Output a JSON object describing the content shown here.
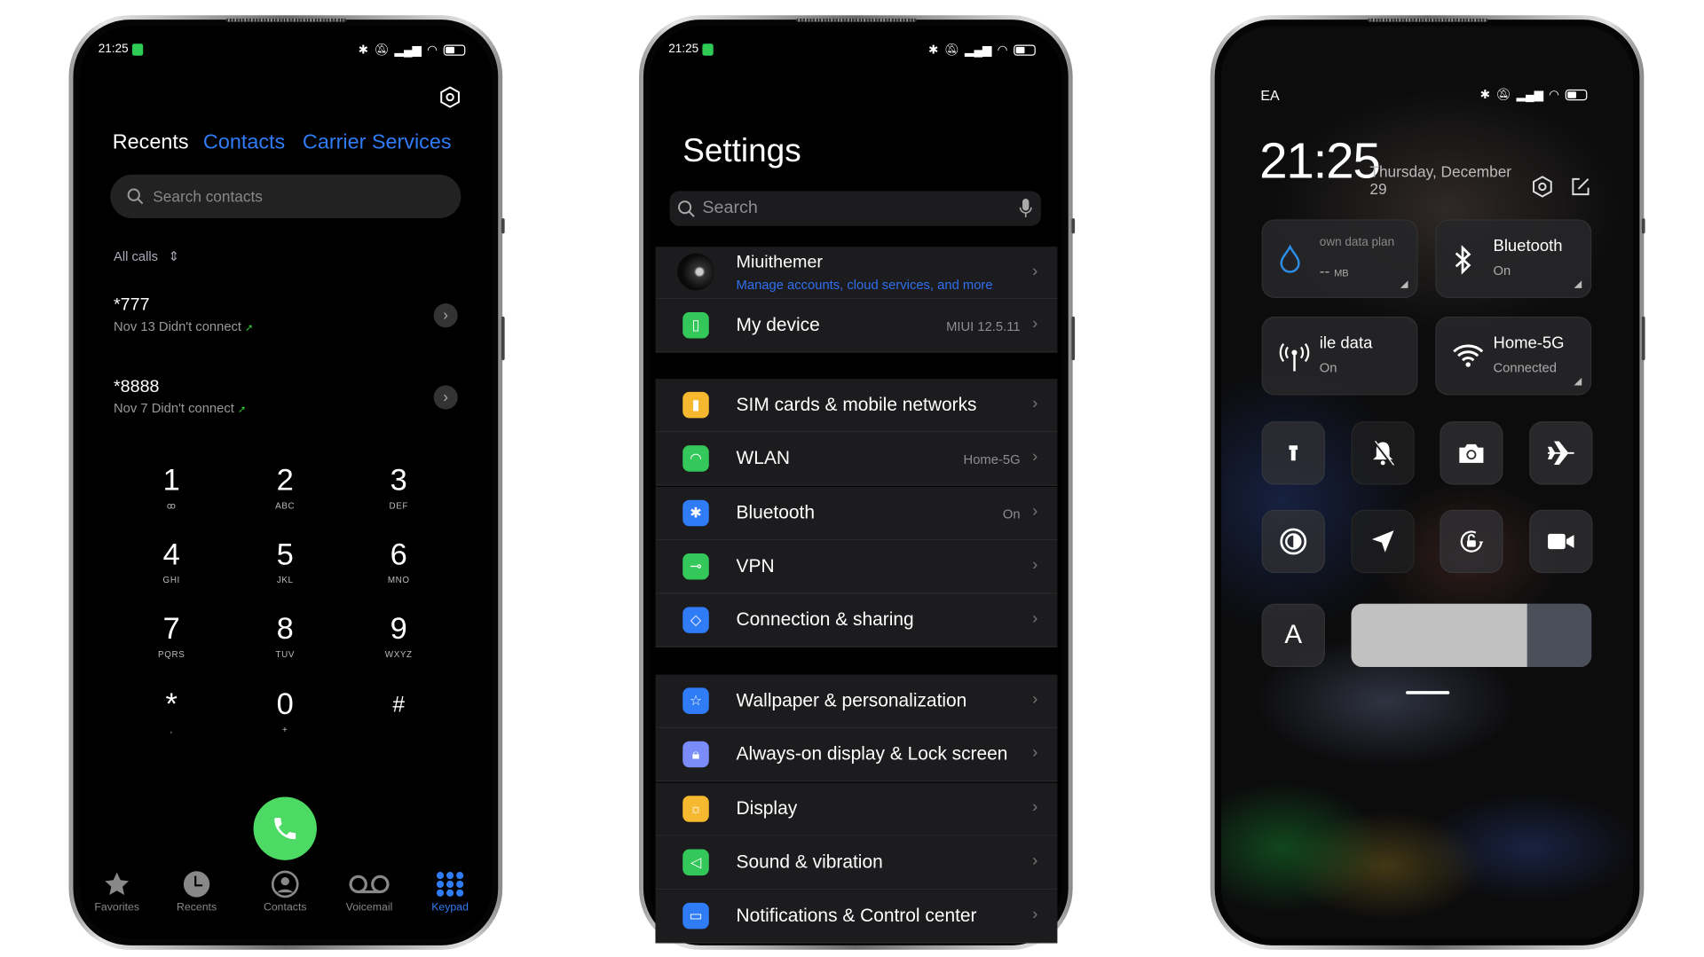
{
  "colors": {
    "accent_blue": "#2f7cf6",
    "call_green": "#4cd964",
    "row_bg": "#1c1c1e",
    "data_drop": "#2b8fe8"
  },
  "dialer": {
    "status_time": "21:25",
    "tabs": [
      {
        "label": "Recents",
        "active": true
      },
      {
        "label": "Contacts",
        "active": false
      },
      {
        "label": "Carrier Services",
        "active": false
      }
    ],
    "search_placeholder": "Search contacts",
    "filter_label": "All calls",
    "recents": [
      {
        "number": "*777",
        "detail": "Nov 13 Didn't connect"
      },
      {
        "number": "*8888",
        "detail": "Nov 7 Didn't connect"
      }
    ],
    "keys": [
      {
        "d": "1",
        "s": "ꝏ"
      },
      {
        "d": "2",
        "s": "ABC"
      },
      {
        "d": "3",
        "s": "DEF"
      },
      {
        "d": "4",
        "s": "GHI"
      },
      {
        "d": "5",
        "s": "JKL"
      },
      {
        "d": "6",
        "s": "MNO"
      },
      {
        "d": "7",
        "s": "PQRS"
      },
      {
        "d": "8",
        "s": "TUV"
      },
      {
        "d": "9",
        "s": "WXYZ"
      },
      {
        "d": "*",
        "s": ","
      },
      {
        "d": "0",
        "s": "+"
      },
      {
        "d": "#",
        "s": ""
      }
    ],
    "nav": [
      {
        "label": "Favorites",
        "icon": "star-icon"
      },
      {
        "label": "Recents",
        "icon": "clock-icon"
      },
      {
        "label": "Contacts",
        "icon": "person-icon"
      },
      {
        "label": "Voicemail",
        "icon": "voicemail-icon"
      },
      {
        "label": "Keypad",
        "icon": "keypad-icon",
        "active": true
      }
    ]
  },
  "settings": {
    "status_time": "21:25",
    "title": "Settings",
    "search_placeholder": "Search",
    "account": {
      "name": "Miuithemer",
      "subtitle": "Manage accounts, cloud services, and more"
    },
    "groups": [
      [
        {
          "label": "My device",
          "value": "MIUI 12.5.11",
          "icon": "phone-icon",
          "color": "#34c759"
        }
      ],
      [
        {
          "label": "SIM cards & mobile networks",
          "value": "",
          "icon": "sim-icon",
          "color": "#f5b82e"
        },
        {
          "label": "WLAN",
          "value": "Home-5G",
          "icon": "wifi-icon",
          "color": "#34c759"
        },
        {
          "label": "Bluetooth",
          "value": "On",
          "icon": "bluetooth-icon",
          "color": "#2f7cf6"
        },
        {
          "label": "VPN",
          "value": "",
          "icon": "key-icon",
          "color": "#34c759"
        },
        {
          "label": "Connection & sharing",
          "value": "",
          "icon": "connection-icon",
          "color": "#2f7cf6"
        }
      ],
      [
        {
          "label": "Wallpaper & personalization",
          "value": "",
          "icon": "star-icon",
          "color": "#2f7cf6"
        },
        {
          "label": "Always-on display & Lock screen",
          "value": "",
          "icon": "lock-icon",
          "color": "#7a8cf8"
        },
        {
          "label": "Display",
          "value": "",
          "icon": "sun-icon",
          "color": "#f5b82e"
        },
        {
          "label": "Sound & vibration",
          "value": "",
          "icon": "speaker-icon",
          "color": "#34c759"
        },
        {
          "label": "Notifications & Control center",
          "value": "",
          "icon": "notification-icon",
          "color": "#2f7cf6"
        }
      ]
    ]
  },
  "control_center": {
    "carrier": "EA",
    "clock": "21:25",
    "date_line1": "Thursday, December",
    "date_line2": "29",
    "tiles": [
      {
        "title": "own data plan",
        "sub": "--",
        "unit": "MB",
        "icon": "water-drop-icon"
      },
      {
        "title": "Bluetooth",
        "sub": "On",
        "icon": "bluetooth-icon"
      },
      {
        "title": "ile data",
        "sub": "On",
        "icon": "antenna-icon"
      },
      {
        "title": "Home-5G",
        "sub": "Connected",
        "icon": "wifi-icon"
      }
    ],
    "toggles": [
      "flashlight-icon",
      "bell-off-icon",
      "camera-icon",
      "airplane-icon",
      "reading-mode-icon",
      "location-icon",
      "rotation-lock-icon",
      "video-icon"
    ],
    "auto_brightness_label": "A",
    "brightness_percent": 73
  }
}
